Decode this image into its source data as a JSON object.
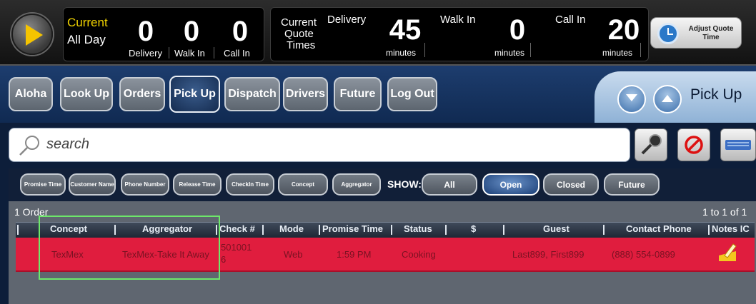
{
  "stats": {
    "current_label": "Current",
    "period": "All Day",
    "delivery": {
      "count": "0",
      "label": "Delivery"
    },
    "walkin": {
      "count": "0",
      "label": "Walk In"
    },
    "callin": {
      "count": "0",
      "label": "Call In"
    }
  },
  "quotes": {
    "title_line1": "Current",
    "title_line2": "Quote",
    "title_line3": "Times",
    "delivery": {
      "label": "Delivery",
      "value": "45",
      "unit": "minutes"
    },
    "walkin": {
      "label": "Walk In",
      "value": "0",
      "unit": "minutes"
    },
    "callin": {
      "label": "Call In",
      "value": "20",
      "unit": "minutes"
    },
    "adjust_label": "Adjust Quote Time"
  },
  "nav": {
    "items": [
      "Aloha",
      "Look Up",
      "Orders",
      "Pick Up",
      "Dispatch",
      "Drivers",
      "Future",
      "Log Out"
    ],
    "active": "Pick Up",
    "screen_title": "Pick Up"
  },
  "search": {
    "placeholder": "search"
  },
  "filters": {
    "sort_buttons": [
      "Promise Time",
      "Customer Name",
      "Phone Number",
      "Release Time",
      "CheckIn Time",
      "Concept",
      "Aggregator"
    ],
    "show_label": "SHOW:",
    "show_options": [
      "All",
      "Open",
      "Closed",
      "Future"
    ],
    "show_active": "Open"
  },
  "list": {
    "count_label": "1 Order",
    "range_label": "1 to 1 of 1",
    "columns": [
      "Concept",
      "Aggregator",
      "Check #",
      "Mode",
      "Promise Time",
      "Status",
      "$",
      "Guest",
      "Contact Phone",
      "Notes IC"
    ],
    "rows": [
      {
        "concept": "TexMex",
        "aggregator": "TexMex-Take It Away",
        "check_line1": "501001",
        "check_line2": "6",
        "mode": "Web",
        "promise_time": "1:59 PM",
        "status": "Cooking",
        "amount": "",
        "guest": "Last899, First899",
        "phone": "(888) 554-0899",
        "notes_icon": "note-pencil-icon"
      }
    ]
  },
  "colors": {
    "row_highlight": "#e01d3e",
    "accent_yellow": "#f0d200",
    "nav_bg": "#1d3d6e",
    "selection_box": "#6de86a"
  }
}
